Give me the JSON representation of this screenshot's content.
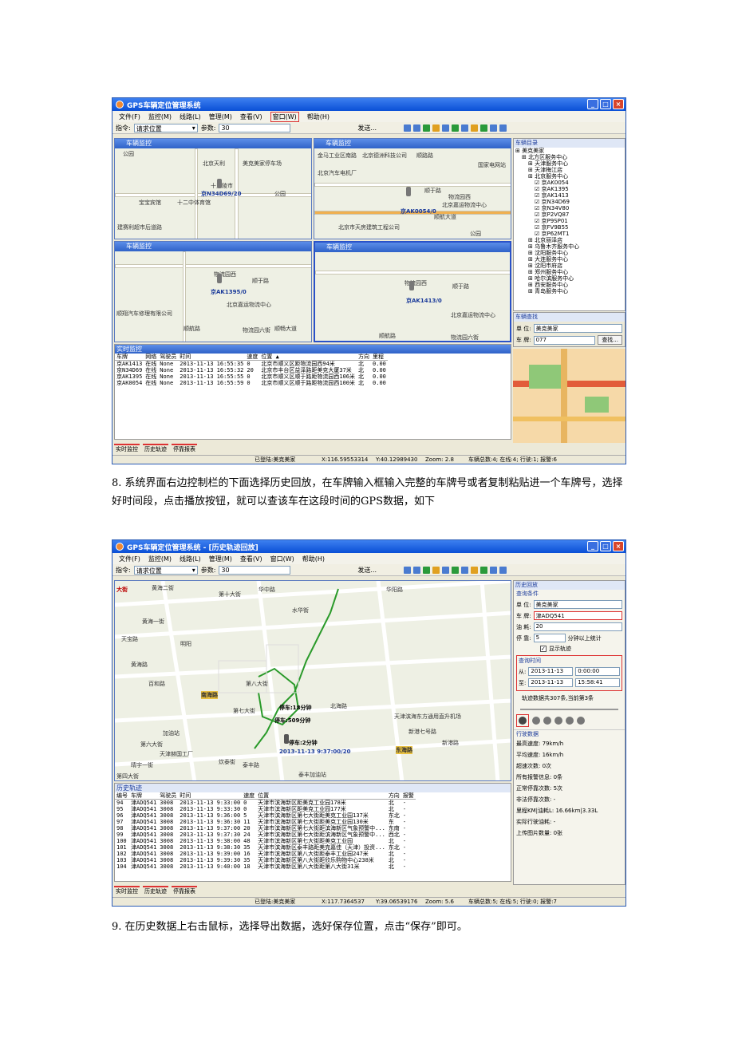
{
  "shot1": {
    "title": "GPS车辆定位管理系统",
    "menus": [
      "文件(F)",
      "监控(M)",
      "线路(L)",
      "管理(M)",
      "查看(V)",
      "窗口(W)",
      "帮助(H)"
    ],
    "menu_highlight": "窗口(W)",
    "toolbar": {
      "cmd_label": "指令:",
      "cmd_value": "请求位置",
      "param_label": "参数:",
      "param_value": "30",
      "send": "发送..."
    },
    "panel_title": "车辆监控",
    "maps": [
      {
        "car": "京N34D69/20",
        "labels": [
          "公园",
          "北京天利",
          "美克美家停车场",
          "十三陵市",
          "宝宝宾馆",
          "十二中体育馆",
          "公园",
          "建赛利超市后道路"
        ]
      },
      {
        "car": "京AK0054/0",
        "labels": [
          "金马工业区南路",
          "北京德洲科技公司",
          "顺路路",
          "北京汽车电机厂",
          "国家电网站",
          "顺于路",
          "物流园西",
          "北京嘉运物流中心",
          "北京市天房建筑工程公司",
          "顺航大道",
          "公园"
        ]
      },
      {
        "car": "京AK1395/0",
        "labels": [
          "物流园西",
          "顺于路",
          "北京嘉运物流中心",
          "顺翔汽车修理有限公司",
          "顺航路",
          "物流园六街",
          "顺畅大道"
        ]
      },
      {
        "car": "京AK1413/0",
        "labels": [
          "物流园西",
          "顺于路",
          "北京嘉运物流中心",
          "顺航路",
          "物流园六街"
        ]
      }
    ],
    "tree_title": "车辆目录",
    "tree": [
      "美克美家",
      "北方区服务中心",
      "天津服务中心",
      "天津梅江店",
      "北京服务中心",
      "京AK0054",
      "京AK1395",
      "京AK1413",
      "京N34D69",
      "京N34V80",
      "京P2VQ87",
      "京P9SP01",
      "京FV9B55",
      "京P62MT1",
      "北京丽泽店",
      "乌鲁木齐服务中心",
      "沈阳服务中心",
      "大连服务中心",
      "沈阳市府店",
      "郑州服务中心",
      "哈尔滨服务中心",
      "西安服务中心",
      "青岛服务中心"
    ],
    "find_title": "车辆查找",
    "unit_label": "单 位:",
    "unit_value": "美克美家",
    "plate_label": "车 牌:",
    "plate_value": "077",
    "find_btn": "查找...",
    "grid_title": "实时监控",
    "grid_headers": [
      "车牌",
      "网络",
      "驾驶员",
      "时间",
      "速度",
      "位置 ▲",
      "方向",
      "里程"
    ],
    "grid_rows": [
      [
        "京AK1413",
        "在线",
        "None",
        "2013-11-13 16:55:35",
        "0",
        "北京市顺义区距物流园西94米",
        "北",
        "0.00"
      ],
      [
        "京N34D69",
        "在线",
        "None",
        "2013-11-13 16:55:32",
        "20",
        "北京市丰台区益泽路距美克大厦37米",
        "北",
        "0.00"
      ],
      [
        "京AK1395",
        "在线",
        "None",
        "2013-11-13 16:55:55",
        "0",
        "北京市顺义区顺于路距物流园西106米",
        "北",
        "0.00"
      ],
      [
        "京AK0054",
        "在线",
        "None",
        "2013-11-13 16:55:59",
        "0",
        "北京市顺义区顺于路距物流园西100米",
        "北",
        "0.00"
      ]
    ],
    "tabs": [
      "实时监控",
      "历史轨迹",
      "停靠报表"
    ],
    "status": {
      "login": "已登陆:美克美家",
      "x": "X:116.59553314",
      "y": "Y:40.12989430",
      "zoom": "Zoom: 2.8",
      "counts": "车辆总数:4; 在线:4; 行驶:1; 报警:6"
    }
  },
  "para8": "8. 系统界面右边控制栏的下面选择历史回放，在车牌输入框输入完整的车牌号或者复制粘贴进一个车牌号，选择好时间段，点击播放按钮，就可以查该车在这段时间的GPS数据，如下",
  "shot2": {
    "title": "GPS车辆定位管理系统 - [历史轨迹回放]",
    "menus": [
      "文件(F)",
      "监控(M)",
      "线路(L)",
      "管理(M)",
      "查看(V)",
      "窗口(W)",
      "帮助(H)"
    ],
    "toolbar": {
      "cmd_label": "指令:",
      "cmd_value": "请求位置",
      "param_label": "参数:",
      "param_value": "30",
      "send": "发送..."
    },
    "map_labels": [
      "大街",
      "黄海二街",
      "第十大街",
      "华中路",
      "华阳路",
      "水华街",
      "黄海一街",
      "天宝路",
      "明阳",
      "黄海路",
      "百和路",
      "南海路",
      "第八大街",
      "第七大街",
      "北海路",
      "天津滨海东方通用直升机场",
      "新港七号路",
      "东海路",
      "新港路",
      "第六大街",
      "天津赫国工厂",
      "炊泰街",
      "泰丰路",
      "第四大街",
      "晴宇一街",
      "泰丰加油站",
      "加油站"
    ],
    "map_stops": [
      "停车:18分钟",
      "停车:509分钟",
      "停车:2分钟"
    ],
    "map_car": "2013-11-13 9:37:00/20",
    "hist_title": "历史回放",
    "query_cond": "查询条件",
    "unit_label": "单 位:",
    "unit_value": "美克美家",
    "plate_label": "车 牌:",
    "plate_value": "津ADQ541",
    "fuel_label": "油 耗:",
    "fuel_value": "20",
    "stop_label": "停 靠:",
    "stop_value": "5",
    "stop_unit": "分钟以上统计",
    "show_track": "显示轨迹",
    "time_title": "查询时间",
    "from_label": "从:",
    "from_date": "2013-11-13",
    "from_time": "0:00:00",
    "to_label": "至:",
    "to_date": "2013-11-13",
    "to_time": "15:58:41",
    "track_info": "轨迹数据共307条,当前第3条",
    "stats_title": "行驶数据",
    "stats": [
      "最高速度: 79km/h",
      "平均速度: 16km/h",
      "超速次数: 0次",
      "所有报警信息: 0条",
      "正常停靠次数: 5次",
      "非法停靠次数: -",
      "里程KM|油耗L: 16.66km|3.33L",
      "实际行驶油耗: -",
      "上传图片数量: 0张"
    ],
    "grid_title": "历史轨迹",
    "grid_headers": [
      "编号",
      "车牌",
      "驾驶员",
      "时间",
      "速度",
      "位置",
      "方向",
      "报警"
    ],
    "grid_rows": [
      [
        "94",
        "津ADQ541",
        "3008",
        "2013-11-13 9:33:00",
        "0",
        "天津市滨海新区距美克工业园178米",
        "北",
        "-"
      ],
      [
        "95",
        "津ADQ541",
        "3008",
        "2013-11-13 9:33:30",
        "0",
        "天津市滨海新区距美克工业园177米",
        "北",
        "-"
      ],
      [
        "96",
        "津ADQ541",
        "3008",
        "2013-11-13 9:36:00",
        "5",
        "天津市滨海新区第七大街距美克工业园137米",
        "东北",
        "-"
      ],
      [
        "97",
        "津ADQ541",
        "3008",
        "2013-11-13 9:36:30",
        "11",
        "天津市滨海新区第七大街距美克工业园130米",
        "东",
        "-"
      ],
      [
        "98",
        "津ADQ541",
        "3008",
        "2013-11-13 9:37:00",
        "20",
        "天津市滨海新区第七大街距滨海新区气象预警中...",
        "东南",
        "-"
      ],
      [
        "99",
        "津ADQ541",
        "3008",
        "2013-11-13 9:37:30",
        "24",
        "天津市滨海新区第七大街距滨海新区气象预警中...",
        "西北",
        "-"
      ],
      [
        "100",
        "津ADQ541",
        "3008",
        "2013-11-13 9:38:00",
        "48",
        "天津市滨海新区第七大街距美克工业园",
        "北",
        "-"
      ],
      [
        "101",
        "津ADQ541",
        "3008",
        "2013-11-13 9:38:30",
        "35",
        "天津市滨海新区泰丰路距美克嘉佳（天津）投资...",
        "东北",
        "-"
      ],
      [
        "102",
        "津ADQ541",
        "3008",
        "2013-11-13 9:39:00",
        "16",
        "天津市滨海新区第八大街距泰丰工业园247米",
        "北",
        "-"
      ],
      [
        "103",
        "津ADQ541",
        "3008",
        "2013-11-13 9:39:30",
        "35",
        "天津市滨海新区第八大街距欣乐购物中心238米",
        "北",
        "-"
      ],
      [
        "104",
        "津ADQ541",
        "3008",
        "2013-11-13 9:40:00",
        "18",
        "天津市滨海新区第八大街距第八大街31米",
        "北",
        "-"
      ]
    ],
    "tabs": [
      "实时监控",
      "历史轨迹",
      "停靠报表"
    ],
    "status": {
      "login": "已登陆:美克美家",
      "x": "X:117.7364537",
      "y": "Y:39.06539176",
      "zoom": "Zoom: 5.6",
      "counts": "车辆总数:5; 在线:5; 行驶:0; 报警:7"
    }
  },
  "para9": "9. 在历史数据上右击鼠标，选择导出数据，选好保存位置，点击“保存”即可。"
}
